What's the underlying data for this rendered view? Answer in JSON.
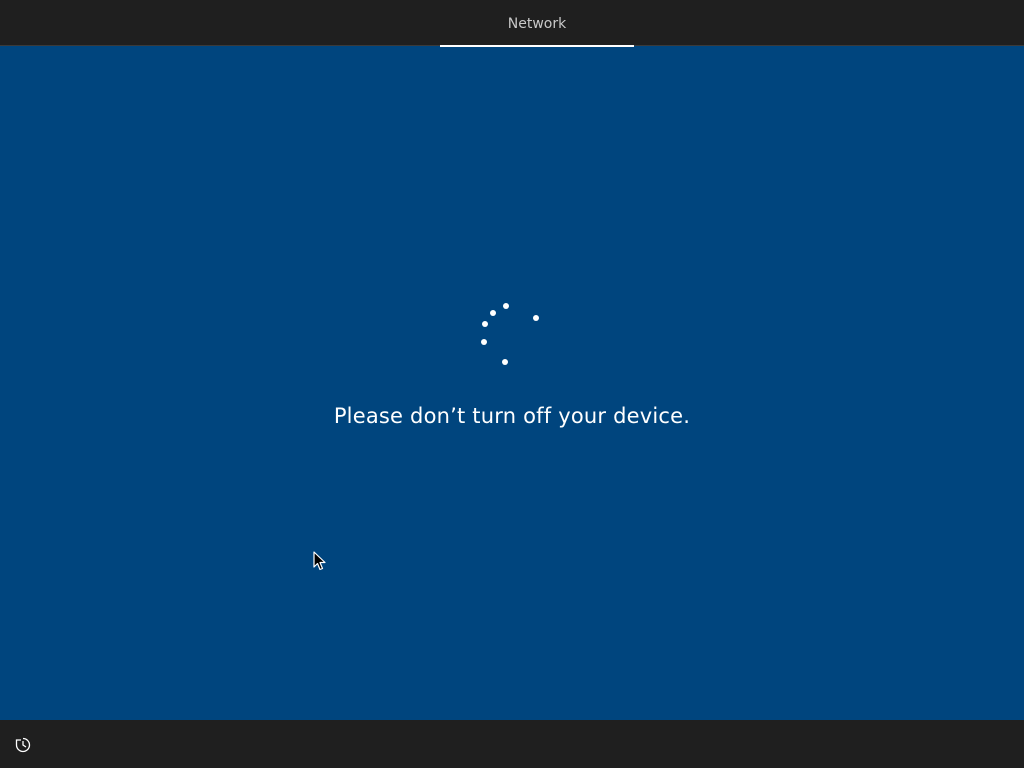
{
  "header": {
    "active_tab_label": "Network"
  },
  "main": {
    "status_message": "Please don’t turn off your device."
  },
  "footer": {
    "accessibility_icon": "ease-of-access-icon"
  },
  "colors": {
    "background": "#00457e",
    "bars": "#1f1f1f",
    "text": "#ffffff"
  }
}
